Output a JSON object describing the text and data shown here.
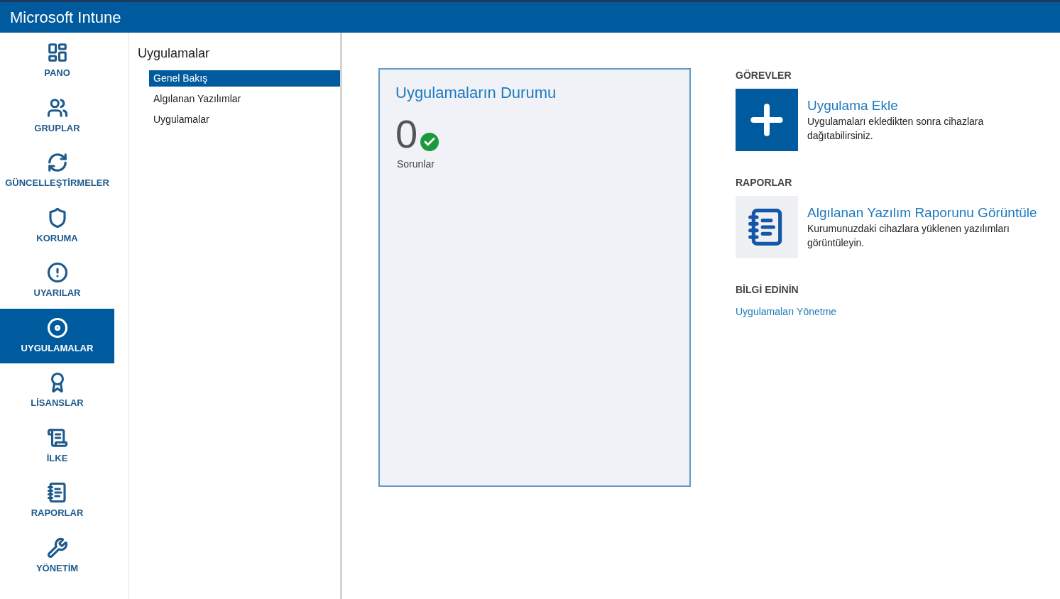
{
  "header": {
    "title": "Microsoft Intune"
  },
  "nav": [
    {
      "label": "PANO",
      "selected": false
    },
    {
      "label": "GRUPLAR",
      "selected": false
    },
    {
      "label": "GÜNCELLEŞTİRMELER",
      "selected": false
    },
    {
      "label": "KORUMA",
      "selected": false
    },
    {
      "label": "UYARILAR",
      "selected": false
    },
    {
      "label": "UYGULAMALAR",
      "selected": true
    },
    {
      "label": "LİSANSLAR",
      "selected": false
    },
    {
      "label": "İLKE",
      "selected": false
    },
    {
      "label": "RAPORLAR",
      "selected": false
    },
    {
      "label": "YÖNETİM",
      "selected": false
    }
  ],
  "subnav": {
    "title": "Uygulamalar",
    "items": [
      {
        "label": "Genel Bakış",
        "selected": true
      },
      {
        "label": "Algılanan Yazılımlar",
        "selected": false
      },
      {
        "label": "Uygulamalar",
        "selected": false
      }
    ]
  },
  "status_card": {
    "title": "Uygulamaların Durumu",
    "count": "0",
    "ok": true,
    "caption": "Sorunlar"
  },
  "sections": [
    {
      "heading": "GÖREVLER",
      "kind": "task",
      "link": "Uygulama Ekle",
      "description": "Uygulamaları ekledikten sonra cihazlara dağıtabilirsiniz."
    },
    {
      "heading": "RAPORLAR",
      "kind": "report",
      "link": "Algılanan Yazılım Raporunu Görüntüle",
      "description": "Kurumunuzdaki cihazlara yüklenen yazılımları görüntüleyin."
    },
    {
      "heading": "BİLGİ EDİNİN",
      "kind": "learn",
      "link": "Uygulamaları Yönetme"
    }
  ]
}
